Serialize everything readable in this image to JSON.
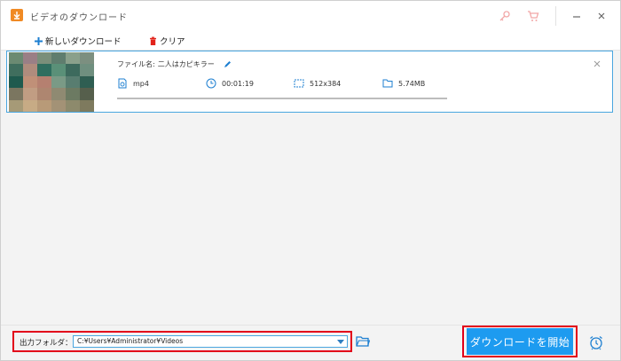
{
  "window": {
    "title": "ビデオのダウンロード"
  },
  "titlebar": {
    "icons": [
      "key-icon",
      "cart-icon",
      "minimize-icon",
      "close-icon"
    ]
  },
  "toolbar": {
    "new_download_label": "新しいダウンロード",
    "clear_label": "クリア"
  },
  "download_item": {
    "filename_label": "ファイル名:",
    "filename": "二人はカピキラー",
    "format": "mp4",
    "duration": "00:01:19",
    "resolution": "512x384",
    "size": "5.74MB"
  },
  "bottom": {
    "output_folder_label": "出力フォルダ：",
    "output_folder_path": "C:¥Users¥Administrator¥Videos",
    "start_download_label": "ダウンロードを開始"
  },
  "colors": {
    "accent": "#1d9bf0",
    "highlight": "#e2001a",
    "app_icon": "#f08a24"
  }
}
